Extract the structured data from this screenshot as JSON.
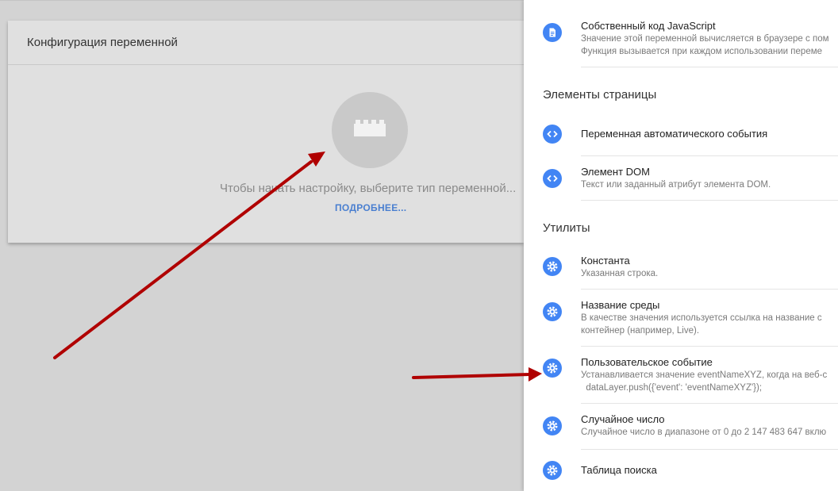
{
  "card": {
    "title": "Конфигурация переменной",
    "prompt": "Чтобы начать настройку, выберите тип переменной...",
    "learn_more": "ПОДРОБНЕЕ..."
  },
  "panel": {
    "top_item": {
      "name": "Собственный код JavaScript",
      "desc1": "Значение этой переменной вычисляется в браузере с пом",
      "desc2": "Функция вызывается при каждом использовании переме"
    },
    "sections": [
      {
        "title": "Элементы страницы",
        "items": [
          {
            "name": "Переменная автоматического события",
            "desc1": "",
            "desc2": "",
            "icon": "code-icon"
          },
          {
            "name": "Элемент DOM",
            "desc1": "Текст или заданный атрибут элемента DOM.",
            "desc2": "",
            "icon": "code-icon"
          }
        ]
      },
      {
        "title": "Утилиты",
        "items": [
          {
            "name": "Константа",
            "desc1": "Указанная строка.",
            "desc2": "",
            "icon": "gear-icon"
          },
          {
            "name": "Название среды",
            "desc1": "В качестве значения используется ссылка на название с",
            "desc2": "контейнер (например, Live).",
            "icon": "gear-icon"
          },
          {
            "name": "Пользовательское событие",
            "desc1": "Устанавливается значение eventNameXYZ, когда на веб-с",
            "desc2": "  dataLayer.push({'event': 'eventNameXYZ'});",
            "icon": "gear-icon"
          },
          {
            "name": "Случайное число",
            "desc1": "Случайное число в диапазоне от 0 до 2 147 483 647 вклю",
            "desc2": "",
            "icon": "gear-icon"
          },
          {
            "name": "Таблица поиска",
            "desc1": "",
            "desc2": "",
            "icon": "gear-icon"
          }
        ]
      }
    ]
  },
  "colors": {
    "accent": "#4285f4",
    "link": "#4a7fd0",
    "arrow": "#b00000"
  }
}
